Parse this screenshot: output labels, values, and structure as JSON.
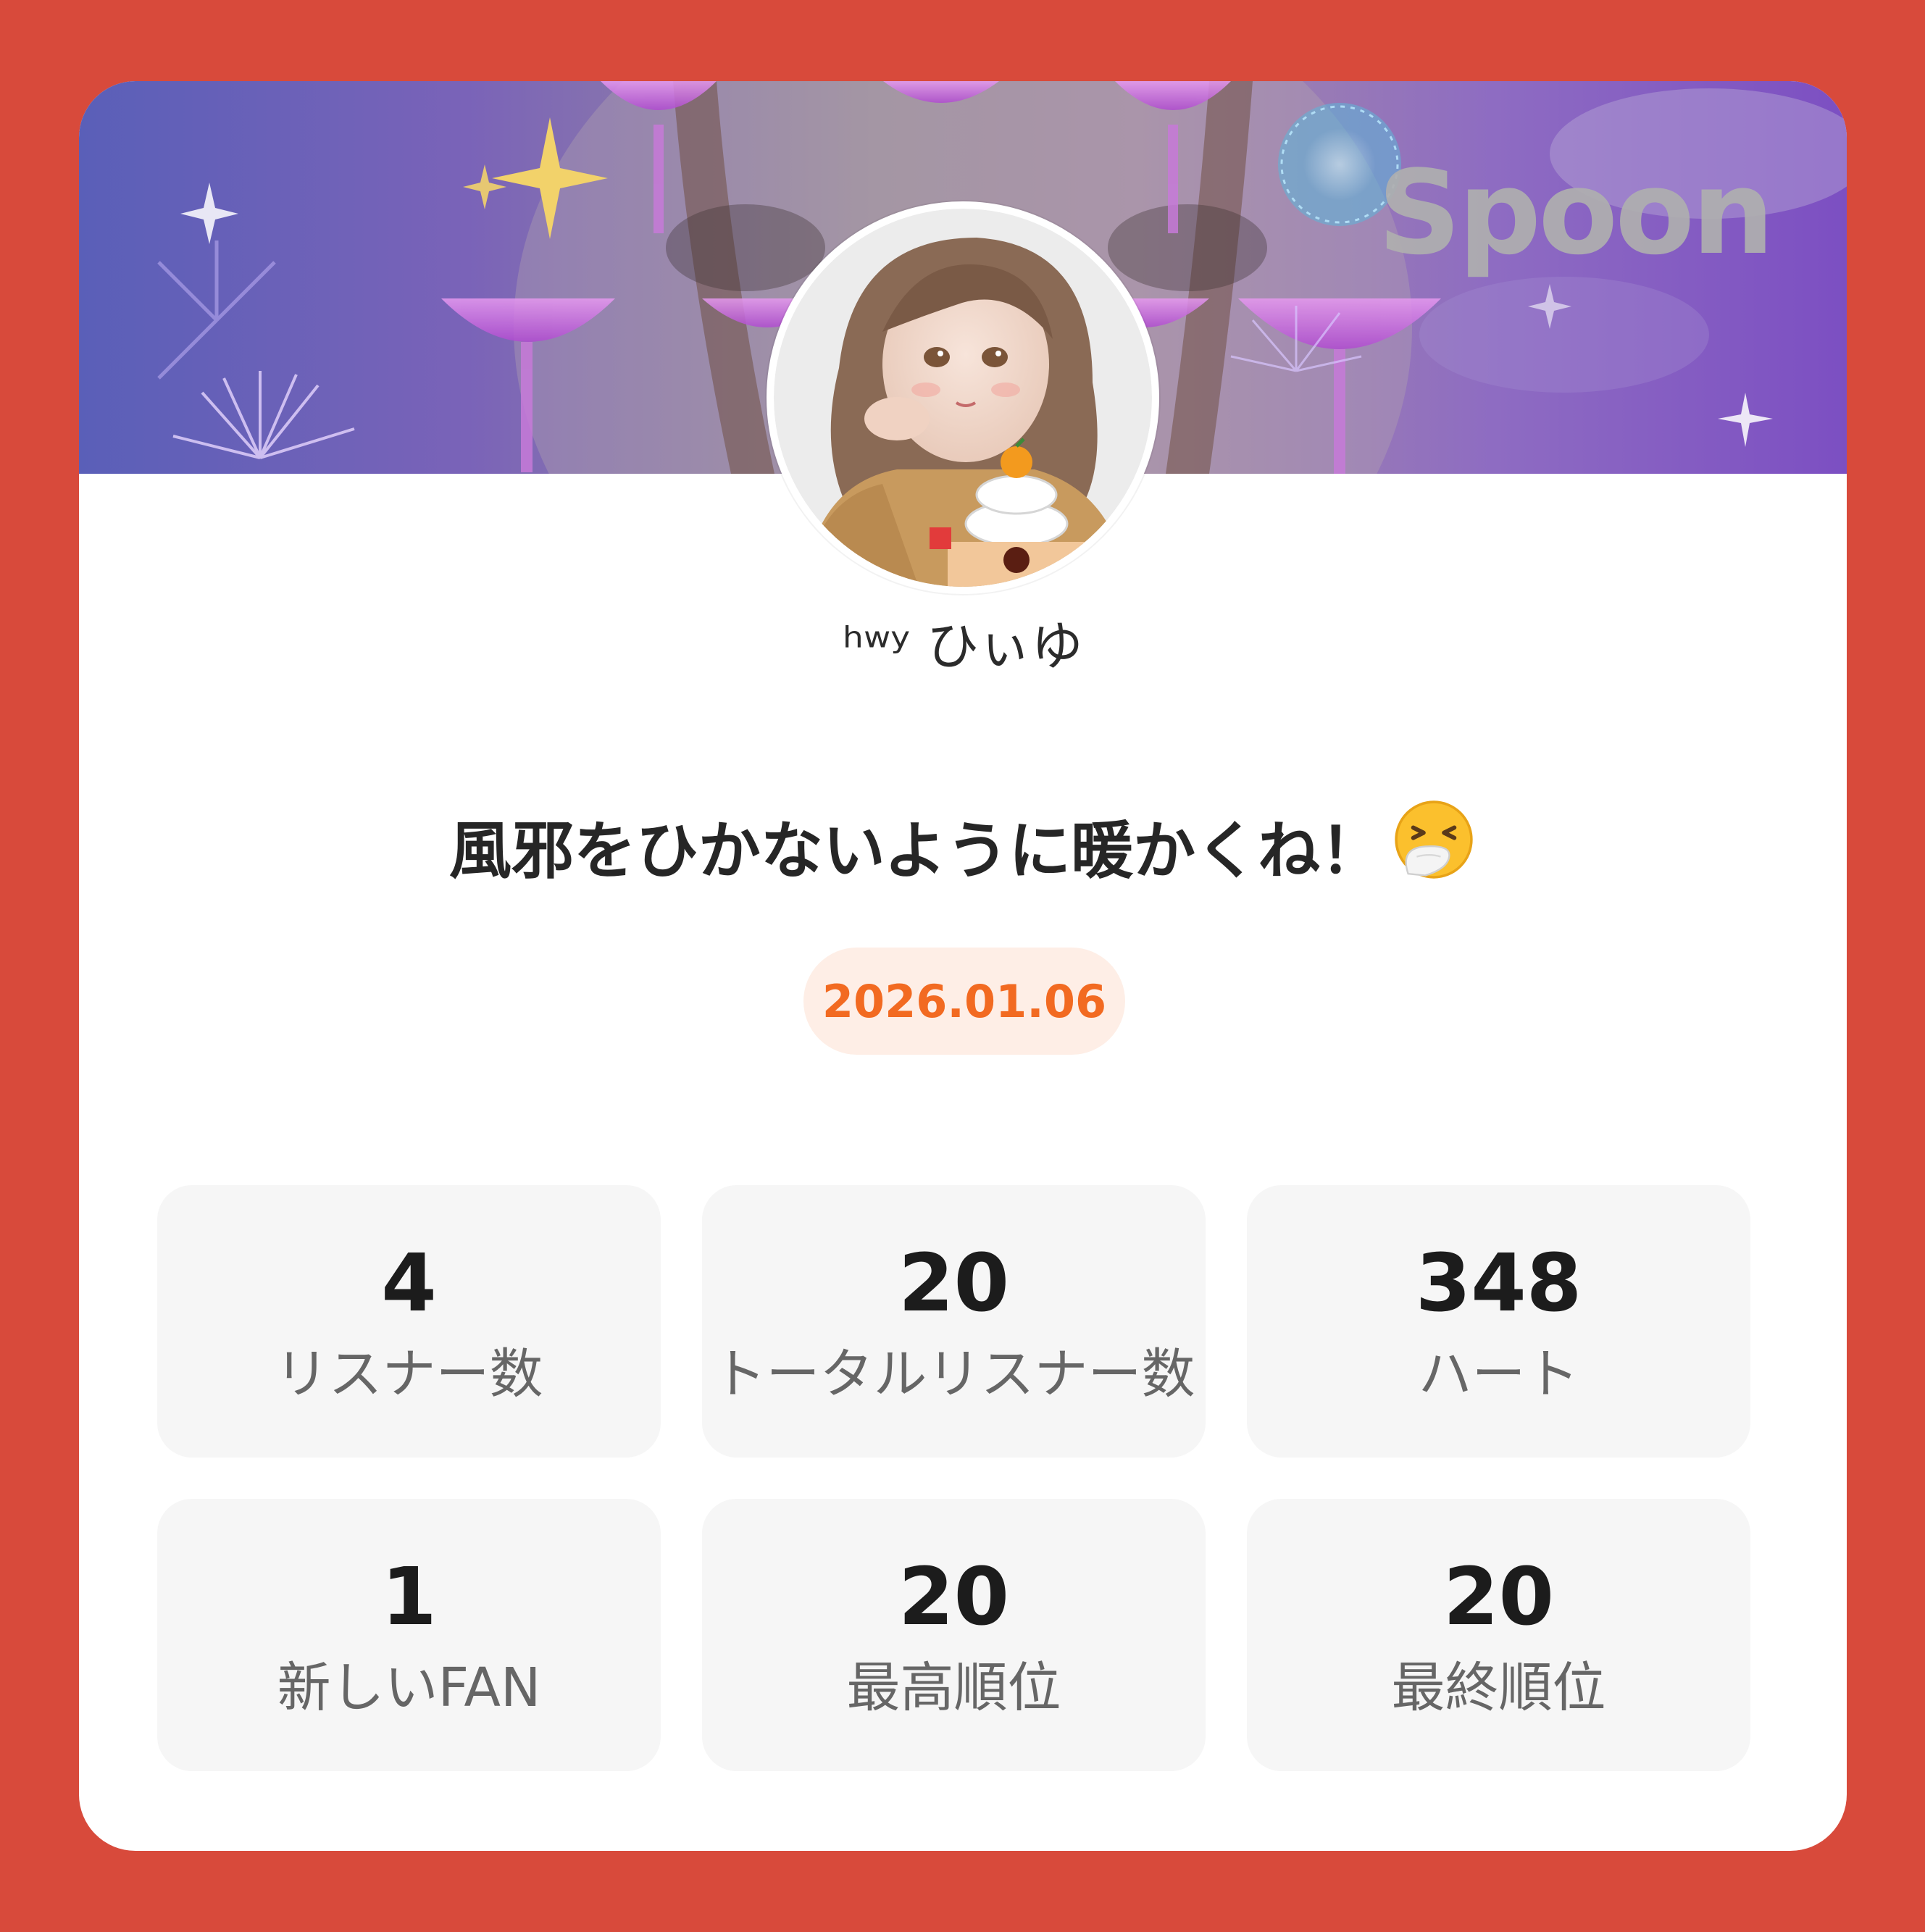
{
  "banner": {
    "logo_text": "Spoon"
  },
  "profile": {
    "username": "ʰʷʸ ひぃゆ",
    "avatar_icon": "avatar-illustration"
  },
  "post": {
    "title": "風邪をひかないように暖かくね！",
    "emoji_icon": "sneezing-face-emoji"
  },
  "date": "2026.01.06",
  "stats": [
    {
      "value": "4",
      "label": "リスナー数"
    },
    {
      "value": "20",
      "label": "トータルリスナー数"
    },
    {
      "value": "348",
      "label": "ハート"
    },
    {
      "value": "1",
      "label": "新しいFAN"
    },
    {
      "value": "20",
      "label": "最高順位"
    },
    {
      "value": "20",
      "label": "最終順位"
    }
  ],
  "colors": {
    "page_background": "#D84A3B",
    "card_background": "#FFFFFF",
    "date_text": "#F26A21",
    "date_pill": "#FEEEE6",
    "stat_tile": "#F6F6F6"
  }
}
